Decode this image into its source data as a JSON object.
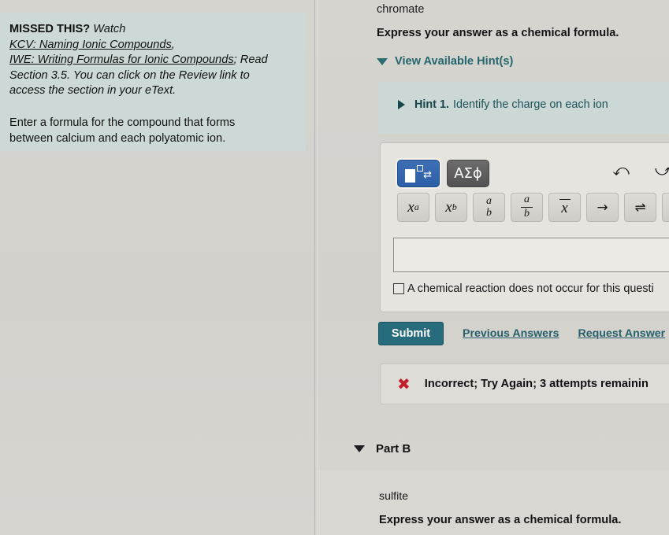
{
  "missed_panel": {
    "heading": "MISSED THIS?",
    "watch_label": "Watch",
    "link1": "KCV: Naming Ionic Compounds",
    "link1_suffix": ",",
    "link2": "IWE: Writing Formulas for Ionic Compounds",
    "link2_suffix": "; Read",
    "read_line2": "Section 3.5. You can click on the Review link to",
    "read_line3": "access the section in your eText.",
    "prompt_line1": "Enter a formula for the compound that forms",
    "prompt_line2": "between calcium and each polyatomic ion."
  },
  "part_a": {
    "ion_name": "chromate",
    "express_instruction": "Express your answer as a chemical formula.",
    "hints_toggle_label": "View Available Hint(s)",
    "hints_toggle_icon": "triangle-down-icon",
    "hint": {
      "expand_icon": "triangle-right-icon",
      "number_label": "Hint 1.",
      "text": "Identify the charge on each ion"
    },
    "toolbar": {
      "template_button_icon": "math-template-icon",
      "greek_button_label": "ΑΣϕ",
      "undo_icon": "undo-arrow-icon",
      "redo_icon": "redo-arrow-icon",
      "reset_icon": "reset-circular-arrow-icon",
      "buttons": [
        {
          "name": "superscript-button",
          "base": "x",
          "sup": "a"
        },
        {
          "name": "subscript-button",
          "base": "x",
          "sub": "b"
        },
        {
          "name": "stacked-ab-button",
          "top": "a",
          "bottom": "b"
        },
        {
          "name": "fraction-button",
          "top": "a",
          "bottom": "b"
        },
        {
          "name": "overbar-button",
          "base": "x"
        },
        {
          "name": "right-arrow-button",
          "glyph": "→"
        },
        {
          "name": "equilibrium-arrow-button",
          "glyph": "⇌"
        },
        {
          "name": "dot-button",
          "glyph": "•"
        }
      ]
    },
    "answer_value": "",
    "answer_placeholder": "",
    "no_reaction_label": "A chemical reaction does not occur for this questi",
    "submit_label": "Submit",
    "previous_answers_label": "Previous Answers",
    "request_answer_label": "Request Answer",
    "feedback": {
      "icon": "red-x-icon",
      "text": "Incorrect; Try Again; 3 attempts remainin",
      "icon_color": "#c21f2e"
    }
  },
  "part_b": {
    "title": "Part B",
    "toggle_icon": "triangle-down-icon",
    "ion_name": "sulfite",
    "express_instruction": "Express your answer as a chemical formula."
  },
  "colors": {
    "page_background": "#d4d2cd",
    "missed_panel_background": "#cdd9d6",
    "hint_box_background": "#ccd8d5",
    "teal_accent": "#24666d",
    "submit_button": "#276c7c",
    "error_red": "#c21f2e"
  }
}
